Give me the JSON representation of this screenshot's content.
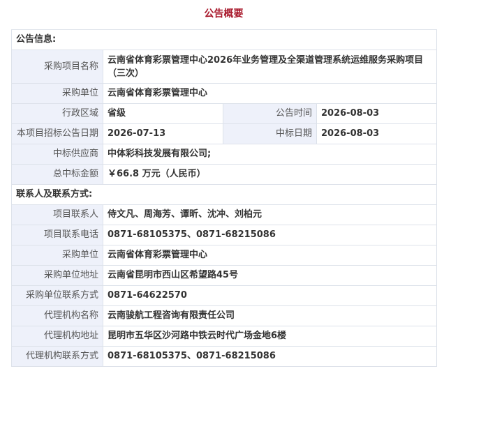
{
  "title": "公告概要",
  "sections": {
    "notice_info": "公告信息:",
    "contact_info": "联系人及联系方式:"
  },
  "fields": {
    "project_name": {
      "label": "采购项目名称",
      "value": "云南省体育彩票管理中心2026年业务管理及全渠道管理系统运维服务采购项目（三次）"
    },
    "purchaser": {
      "label": "采购单位",
      "value": "云南省体育彩票管理中心"
    },
    "region": {
      "label": "行政区域",
      "value": "省级"
    },
    "announce_time": {
      "label": "公告时间",
      "value": "2026-08-03"
    },
    "bid_announce_date": {
      "label": "本项目招标公告日期",
      "value": "2026-07-13"
    },
    "award_date": {
      "label": "中标日期",
      "value": "2026-08-03"
    },
    "supplier": {
      "label": "中标供应商",
      "value": "中体彩科技发展有限公司;"
    },
    "total_amount": {
      "label": "总中标金额",
      "value": "￥66.8 万元（人民币）"
    },
    "project_contact": {
      "label": "项目联系人",
      "value": "侍文凡、周海芳、谭昕、沈冲、刘柏元"
    },
    "project_phone": {
      "label": "项目联系电话",
      "value": "0871-68105375、0871-68215086"
    },
    "contact_purchaser": {
      "label": "采购单位",
      "value": "云南省体育彩票管理中心"
    },
    "purchaser_address": {
      "label": "采购单位地址",
      "value": "云南省昆明市西山区希望路45号"
    },
    "purchaser_phone": {
      "label": "采购单位联系方式",
      "value": "0871-64622570"
    },
    "agency_name": {
      "label": "代理机构名称",
      "value": "云南骏航工程咨询有限责任公司"
    },
    "agency_address": {
      "label": "代理机构地址",
      "value": "昆明市五华区沙河路中铁云时代广场金地6楼"
    },
    "agency_phone": {
      "label": "代理机构联系方式",
      "value": "0871-68105375、0871-68215086"
    }
  },
  "colors": {
    "title": "#a8182b",
    "label_bg": "#eef1fa",
    "border": "#dde2ea"
  }
}
